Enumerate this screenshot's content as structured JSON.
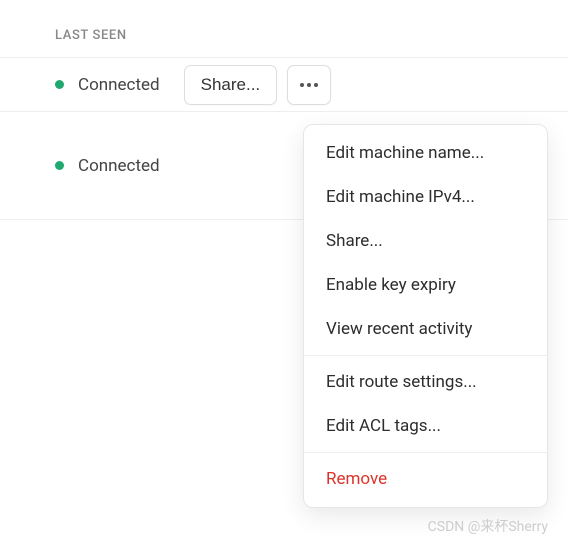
{
  "header": {
    "column_label": "LAST SEEN"
  },
  "rows": [
    {
      "status_text": "Connected",
      "status_color": "#1fa971",
      "share_label": "Share..."
    },
    {
      "status_text": "Connected",
      "status_color": "#1fa971"
    }
  ],
  "menu": {
    "groups": [
      [
        {
          "label": "Edit machine name..."
        },
        {
          "label": "Edit machine IPv4..."
        },
        {
          "label": "Share..."
        },
        {
          "label": "Enable key expiry"
        },
        {
          "label": "View recent activity"
        }
      ],
      [
        {
          "label": "Edit route settings..."
        },
        {
          "label": "Edit ACL tags..."
        }
      ],
      [
        {
          "label": "Remove",
          "danger": true
        }
      ]
    ]
  },
  "watermark": "CSDN @来杯Sherry"
}
